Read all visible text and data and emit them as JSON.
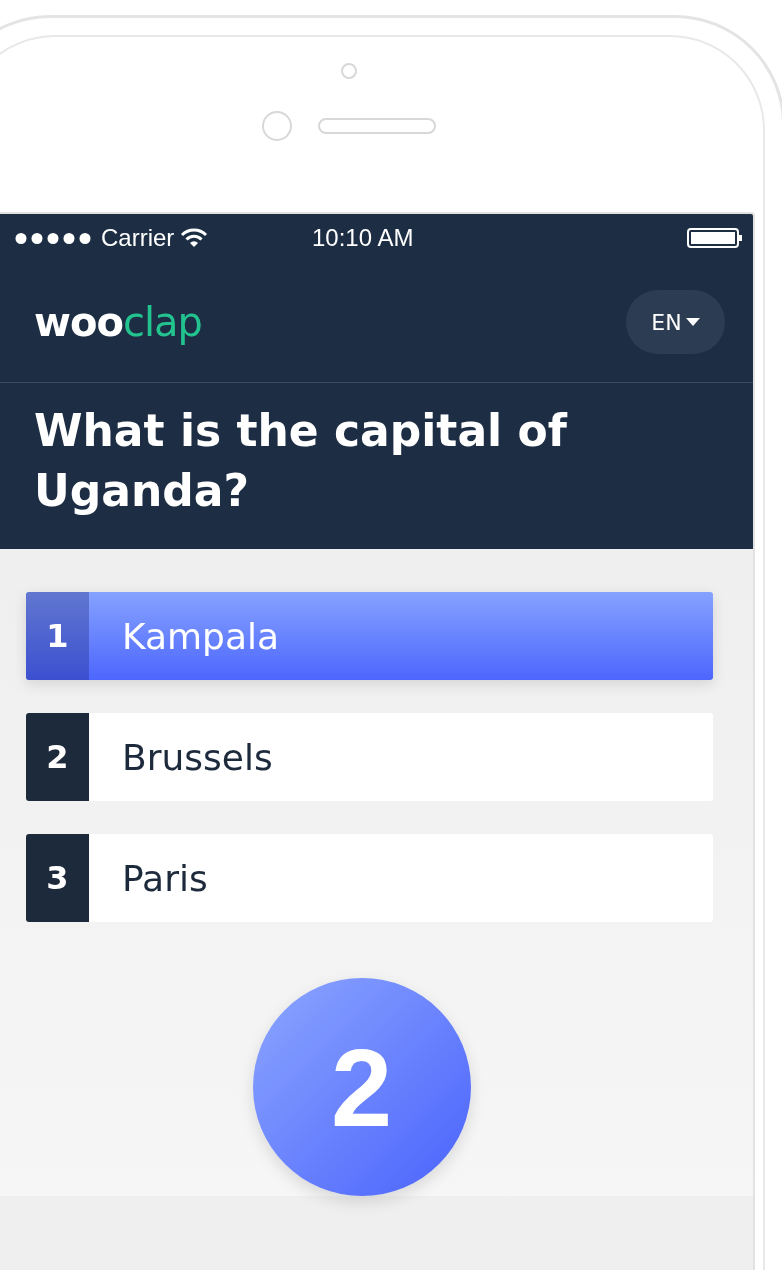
{
  "status_bar": {
    "carrier": "Carrier",
    "time": "10:10 AM"
  },
  "header": {
    "logo": {
      "first": "woo",
      "second": "clap"
    },
    "language": "EN"
  },
  "question": "What is the capital of Uganda?",
  "answers": [
    {
      "number": "1",
      "label": "Kampala",
      "selected": true
    },
    {
      "number": "2",
      "label": "Brussels",
      "selected": false
    },
    {
      "number": "3",
      "label": "Paris",
      "selected": false
    }
  ],
  "counter": "2"
}
